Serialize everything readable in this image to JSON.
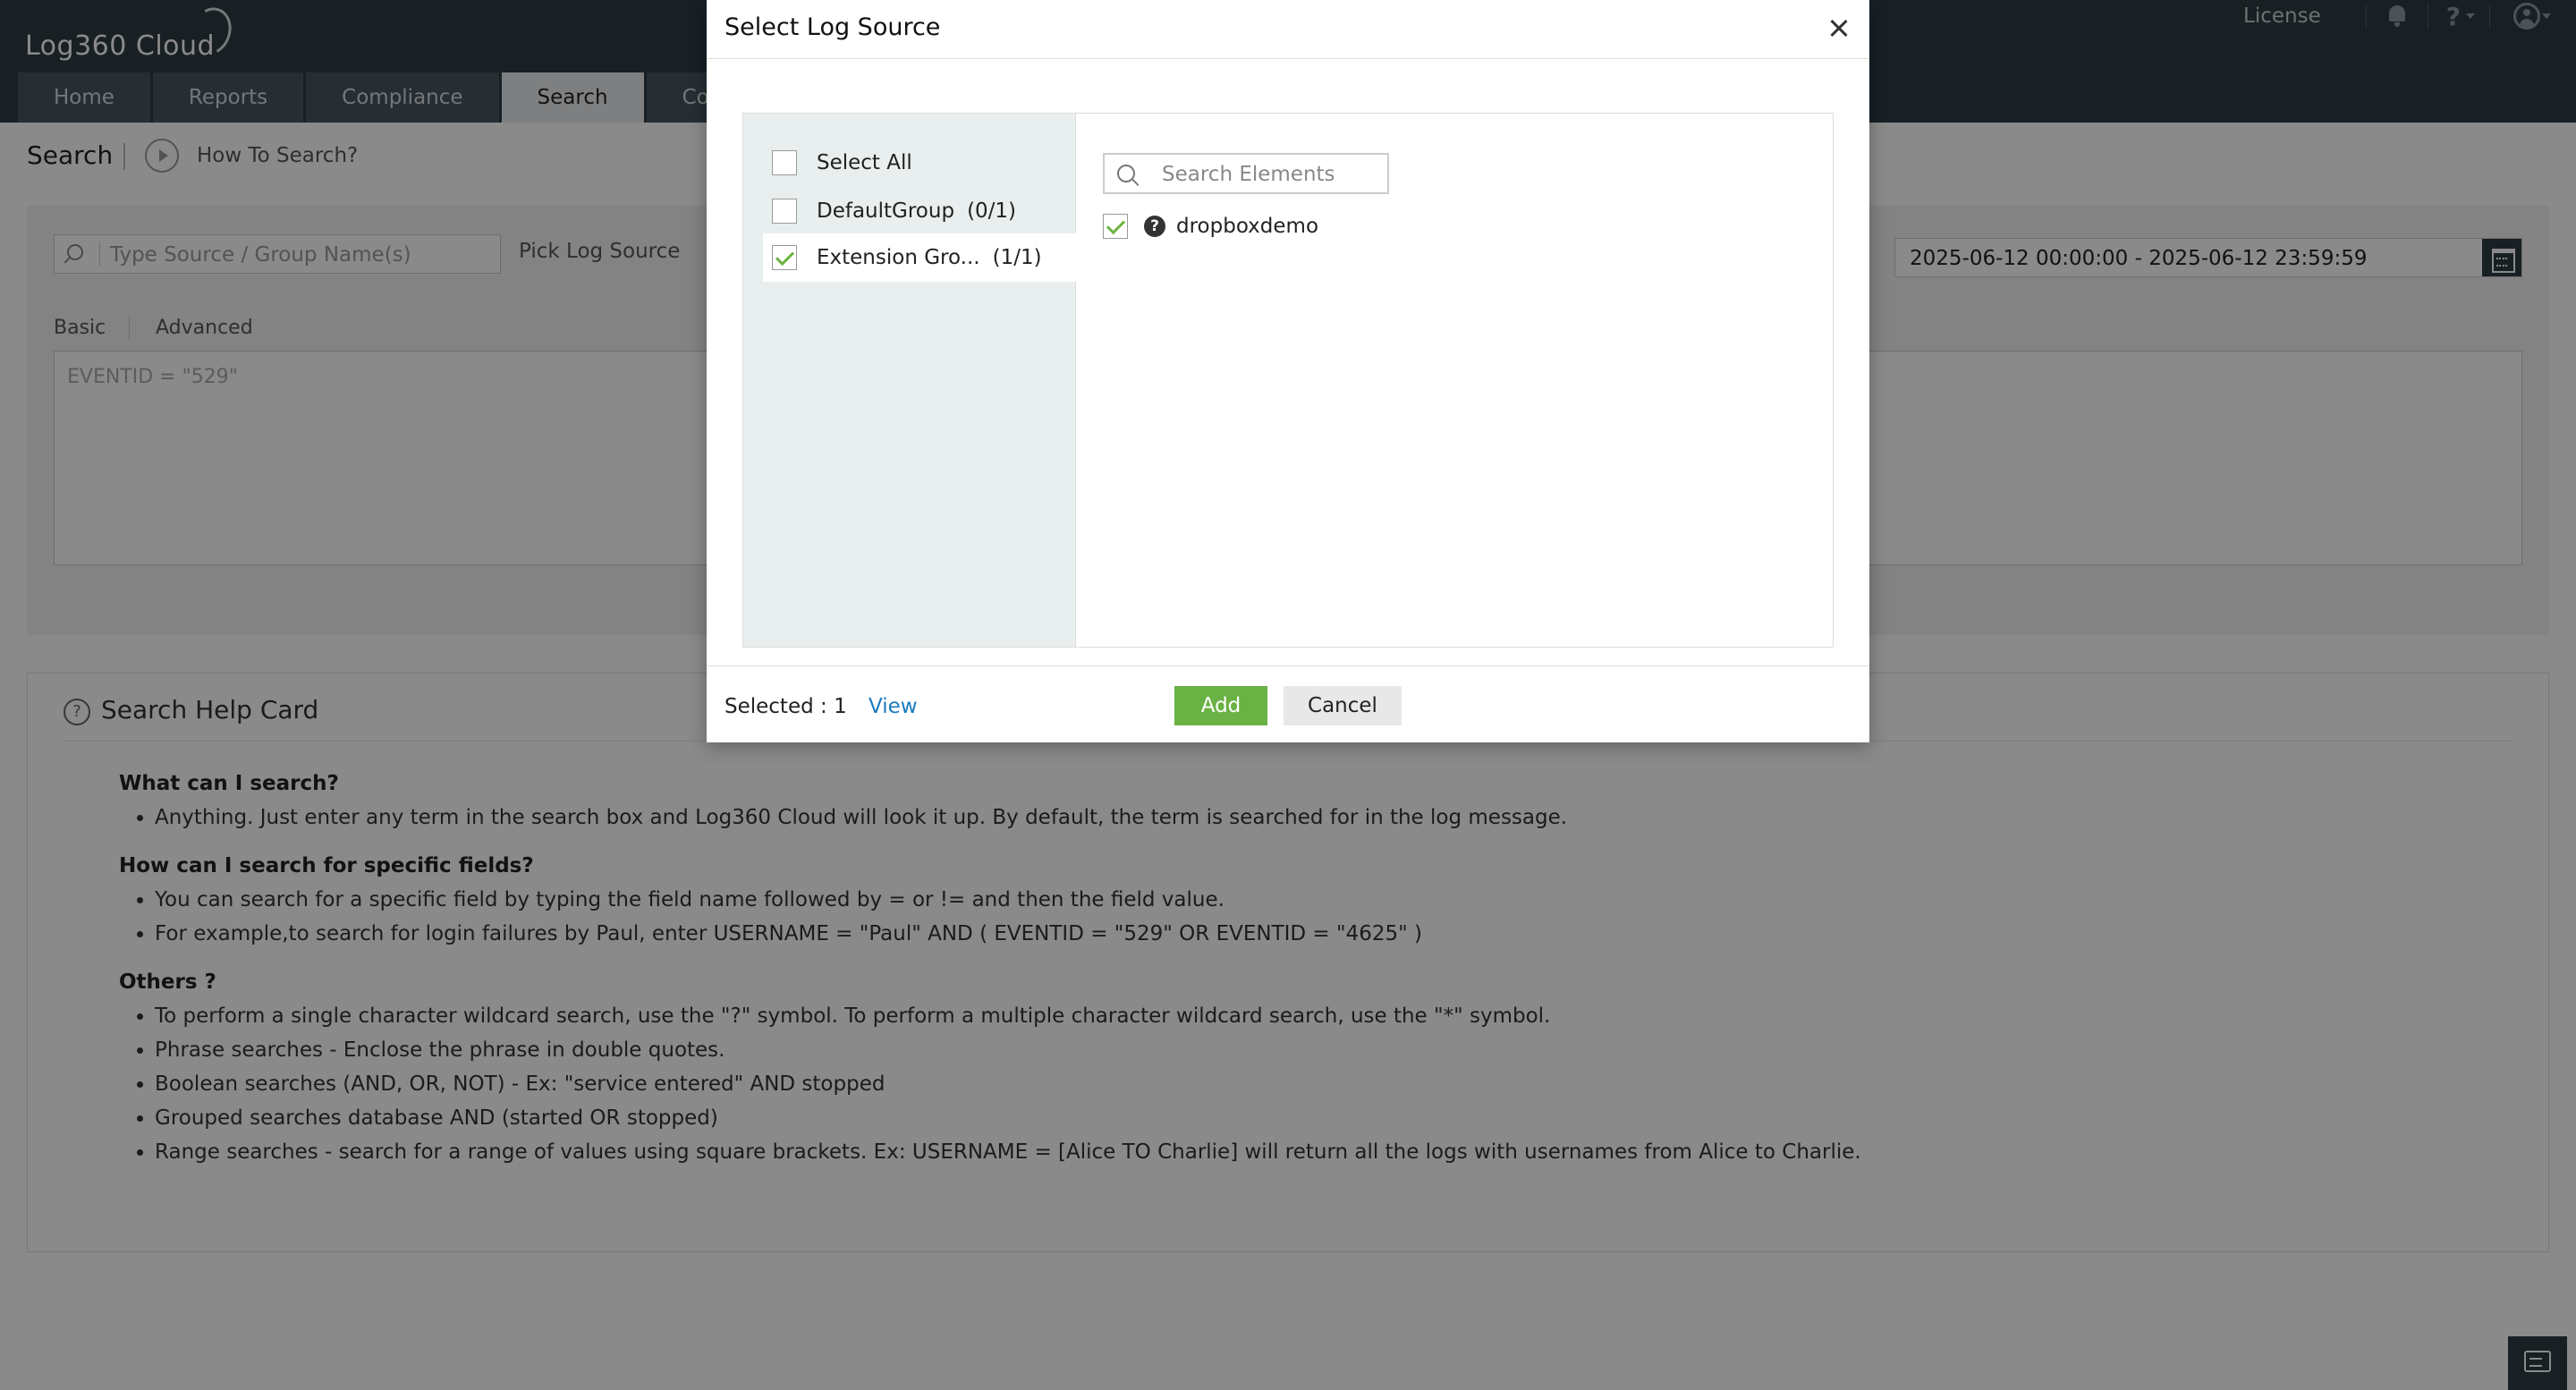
{
  "app": {
    "logo": "Log360 Cloud",
    "license": "License",
    "help_mark": "?",
    "nav_tabs": [
      "Home",
      "Reports",
      "Compliance",
      "Search",
      "Corr"
    ],
    "active_tab": "Search"
  },
  "page": {
    "title": "Search",
    "how_to": "How To Search?",
    "source_placeholder": "Type Source / Group Name(s)",
    "pick_log_source": "Pick Log Source",
    "tabs": [
      "Basic",
      "Advanced"
    ],
    "query_placeholder": "EVENTID = \"529\"",
    "date_range": "2025-06-12 00:00:00 - 2025-06-12 23:59:59"
  },
  "help_card": {
    "title": "Search Help Card",
    "icon": "?",
    "sections": [
      {
        "question": "What can I search?",
        "items": [
          "Anything. Just enter any term in the search box and Log360 Cloud will look it up. By default, the term is searched for in the log message."
        ]
      },
      {
        "question": "How can I search for specific fields?",
        "items": [
          "You can search for a specific field by typing the field name followed by = or != and then the field value.",
          "For example,to search for login failures by Paul, enter USERNAME = \"Paul\" AND ( EVENTID = \"529\" OR EVENTID = \"4625\" )"
        ]
      },
      {
        "question": "Others ?",
        "items": [
          "To perform a single character wildcard search, use the \"?\" symbol. To perform a multiple character wildcard search, use the \"*\" symbol.",
          "Phrase searches - Enclose the phrase in double quotes.",
          "Boolean searches (AND, OR, NOT) - Ex: \"service entered\" AND stopped",
          "Grouped searches database AND (started OR stopped)",
          "Range searches - search for a range of values using square brackets. Ex: USERNAME = [Alice TO Charlie] will return all the logs with usernames from Alice to Charlie."
        ]
      }
    ]
  },
  "modal": {
    "title": "Select Log Source",
    "groups": [
      {
        "label": "Select All",
        "count": "",
        "checked": false,
        "selected": false
      },
      {
        "label": "DefaultGroup",
        "count": "(0/1)",
        "checked": false,
        "selected": false
      },
      {
        "label": "Extension Gro...",
        "count": "(1/1)",
        "checked": true,
        "selected": true
      }
    ],
    "search_placeholder": "Search Elements",
    "elements": [
      {
        "label": "dropboxdemo",
        "checked": true,
        "info": "?"
      }
    ],
    "footer": {
      "selected_text": "Selected : 1",
      "view_label": "View",
      "add_label": "Add",
      "cancel_label": "Cancel"
    }
  },
  "colors": {
    "header_bg": "#2e3c44",
    "accent_green": "#6ab244",
    "link_blue": "#1a7abf"
  }
}
